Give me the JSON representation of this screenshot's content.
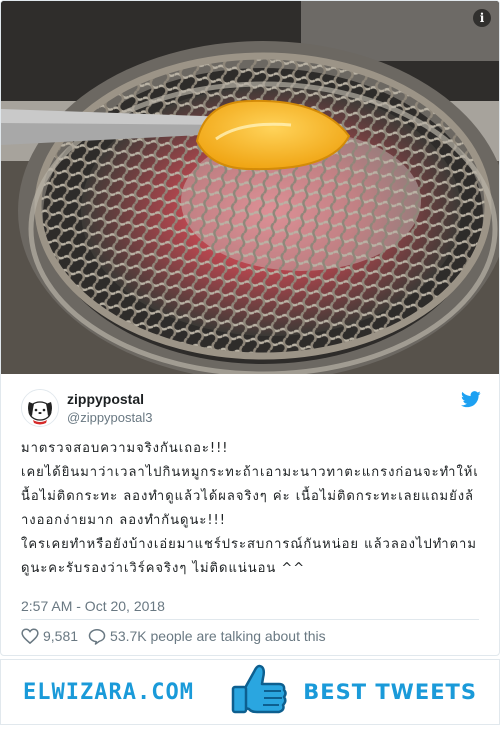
{
  "photo": {
    "alt_icon": "info-icon",
    "info_glyph": "i"
  },
  "author": {
    "name": "zippypostal",
    "handle": "@zippypostal3",
    "avatar_icon": "pochacco-avatar-icon"
  },
  "tweet": {
    "text": "มาตรวจสอบความจริงกันเถอะ!!!\nเคยได้ยินมาว่าเวลาไปกินหมูกระทะถ้าเอามะนาวทาตะแกรงก่อนจะทำให้เนื้อไม่ติดกระทะ ลองทำดูแล้วได้ผลจริงๆ ค่ะ เนื้อไม่ติดกระทะเลยแถมยังล้างออกง่ายมาก ลองทำกันดูนะ!!!\nใครเคยทำหรือยังบ้างเอ่ยมาแชร์ประสบการณ์กันหน่อย แล้วลองไปทำตามดูนะคะรับรองว่าเวิร์คจริงๆ ไม่ติดแน่นอน ^^",
    "timestamp": "2:57 AM - Oct 20, 2018",
    "likes": "9,581",
    "talking": "53.7K people are talking about this"
  },
  "banner": {
    "left_text": "ELWIZARA.COM",
    "right_text": "BEST TWEETS",
    "accent": "#1a9ad9"
  },
  "icons": {
    "twitter": "twitter-bird-icon",
    "like": "heart-icon",
    "reply": "speech-bubble-icon",
    "thumb": "thumbs-up-icon"
  },
  "colors": {
    "twitter_blue": "#1da1f2",
    "muted": "#697882",
    "border": "#e1e8ed"
  }
}
